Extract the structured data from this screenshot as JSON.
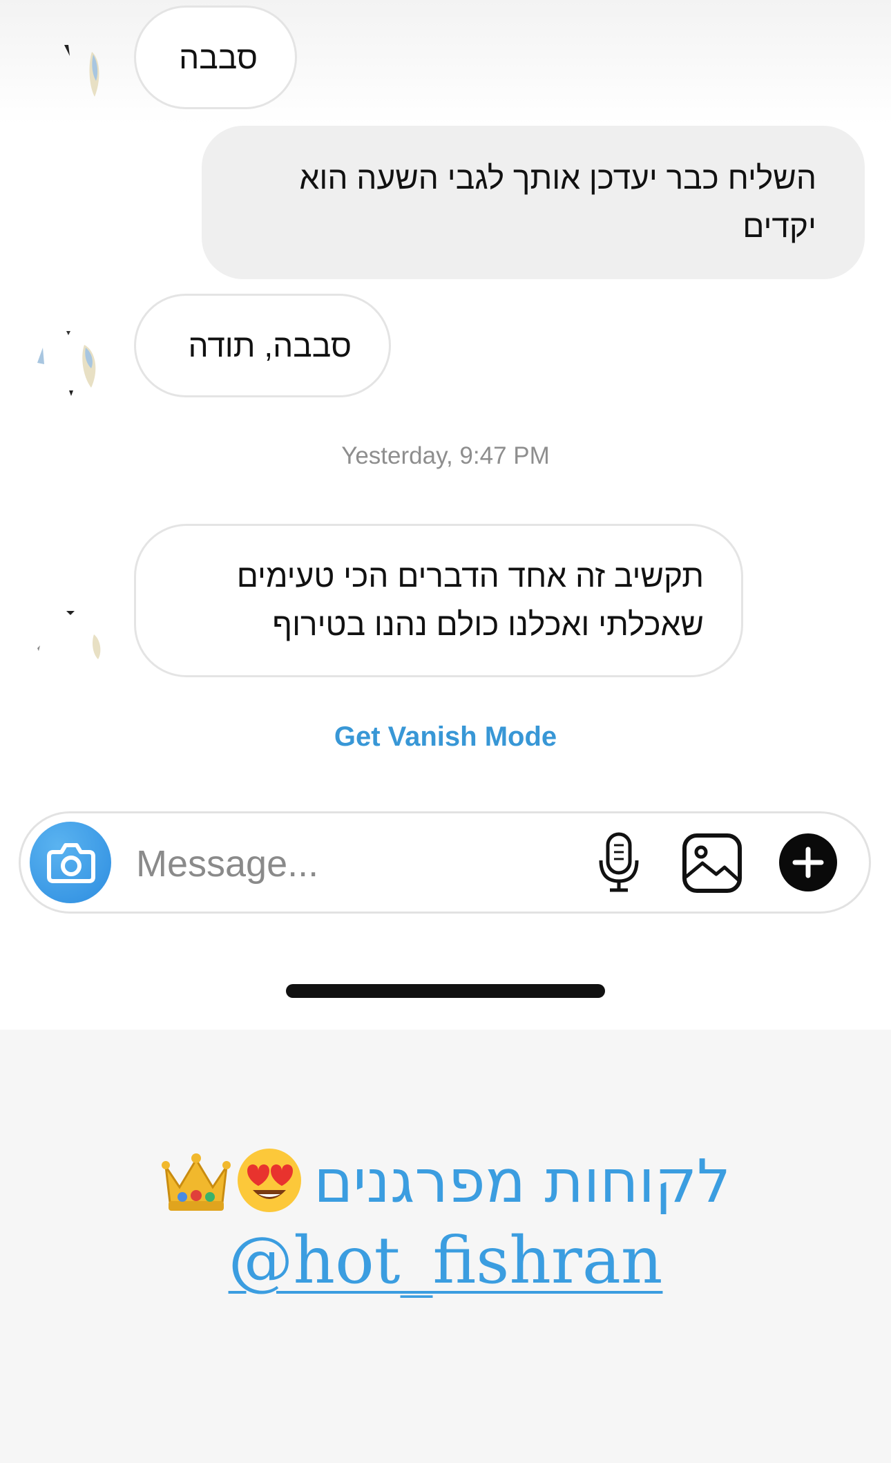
{
  "messages": [
    {
      "direction": "received",
      "text": "סבבה"
    },
    {
      "direction": "sent",
      "text": "השליח כבר יעדכן אותך לגבי השעה הוא\nיקדים"
    },
    {
      "direction": "received",
      "text": "סבבה, תודה"
    },
    {
      "direction": "received",
      "text": "תקשיב זה אחד הדברים הכי טעימים\nשאכלתי ואכלנו כולם נהנו בטירוף"
    }
  ],
  "timestamp": "Yesterday, 9:47 PM",
  "vanish_mode": "Get Vanish Mode",
  "composer": {
    "placeholder": "Message...",
    "icons": [
      "camera-icon",
      "microphone-icon",
      "gallery-icon",
      "add-icon"
    ]
  },
  "story": {
    "caption": "לקוחות מפרגנים",
    "emojis": [
      "heart-eyes-emoji",
      "crown-emoji"
    ],
    "handle": "@hot_fishran"
  },
  "colors": {
    "link_blue": "#3897d6",
    "story_blue": "#3b9de0",
    "sent_bubble": "#efefef",
    "camera_blue": "#2d8de0"
  }
}
